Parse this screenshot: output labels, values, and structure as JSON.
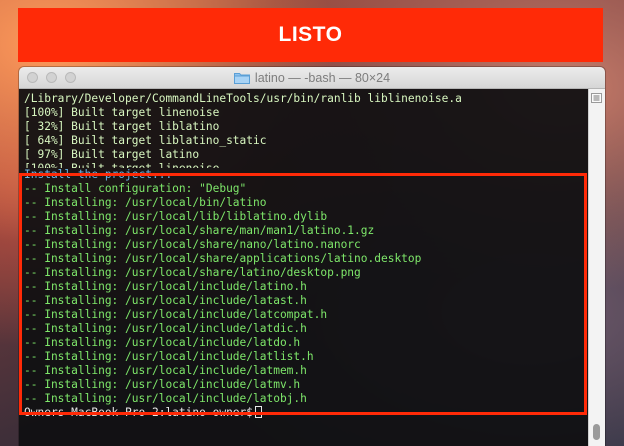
{
  "banner": {
    "text": "LISTO"
  },
  "window": {
    "title": "latino — -bash — 80×24",
    "folder_icon": "folder-icon"
  },
  "terminal": {
    "lines_above": [
      {
        "text": "/Library/Developer/CommandLineTools/usr/bin/ranlib liblinenoise.a",
        "color": "normal"
      },
      {
        "text": "[100%] Built target linenoise",
        "color": "normal"
      },
      {
        "text": "[ 32%] Built target liblatino",
        "color": "normal"
      },
      {
        "text": "[ 64%] Built target liblatino_static",
        "color": "normal"
      },
      {
        "text": "[ 97%] Built target latino",
        "color": "normal"
      },
      {
        "text": "[100%] Built target linenoise",
        "color": "normal"
      }
    ],
    "install_header": "Install the project...",
    "install_lines": [
      "-- Install configuration: \"Debug\"",
      "-- Installing: /usr/local/bin/latino",
      "-- Installing: /usr/local/lib/liblatino.dylib",
      "-- Installing: /usr/local/share/man/man1/latino.1.gz",
      "-- Installing: /usr/local/share/nano/latino.nanorc",
      "-- Installing: /usr/local/share/applications/latino.desktop",
      "-- Installing: /usr/local/share/latino/desktop.png",
      "-- Installing: /usr/local/include/latino.h",
      "-- Installing: /usr/local/include/latast.h",
      "-- Installing: /usr/local/include/latcompat.h",
      "-- Installing: /usr/local/include/latdic.h",
      "-- Installing: /usr/local/include/latdo.h",
      "-- Installing: /usr/local/include/latlist.h",
      "-- Installing: /usr/local/include/latmem.h",
      "-- Installing: /usr/local/include/latmv.h",
      "-- Installing: /usr/local/include/latobj.h"
    ],
    "prompt": "Owners-MacBook-Pro-2:latino owner$"
  },
  "colors": {
    "banner": "#ff2a07",
    "highlight_border": "#ff2a07",
    "text_green": "#7ee76a",
    "text_cyan": "#6ab4e6",
    "terminal_bg": "#101012"
  }
}
